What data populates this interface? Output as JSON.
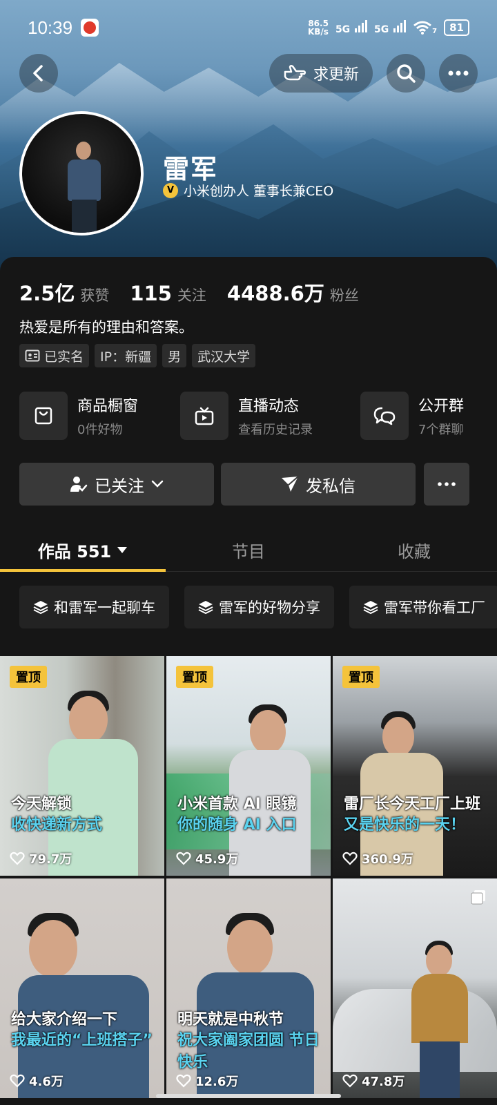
{
  "status_bar": {
    "time": "10:39",
    "net_speed_value": "86.5",
    "net_speed_unit": "KB/s",
    "sig1": "5G",
    "sig2": "5G",
    "wifi_sub": "7",
    "battery": "81"
  },
  "topbar": {
    "update_label": "求更新"
  },
  "profile": {
    "name": "雷军",
    "verified_title": "小米创办人 董事长兼CEO",
    "stats": [
      {
        "num": "2.5亿",
        "label": "获赞"
      },
      {
        "num": "115",
        "label": "关注"
      },
      {
        "num": "4488.6万",
        "label": "粉丝"
      }
    ],
    "bio": "热爱是所有的理由和答案。",
    "tags": [
      {
        "label": "已实名",
        "icon": "id-card-icon"
      },
      {
        "label": "IP：新疆"
      },
      {
        "label": "男"
      },
      {
        "label": "武汉大学"
      }
    ]
  },
  "services": [
    {
      "title": "商品橱窗",
      "subtitle": "0件好物",
      "icon": "shopping-bag-icon"
    },
    {
      "title": "直播动态",
      "subtitle": "查看历史记录",
      "icon": "tv-icon"
    },
    {
      "title": "公开群",
      "subtitle": "7个群聊",
      "icon": "chat-bubbles-icon"
    }
  ],
  "actions": {
    "follow_label": "已关注",
    "message_label": "发私信"
  },
  "tabs": [
    {
      "label": "作品 551",
      "active": true
    },
    {
      "label": "节目"
    },
    {
      "label": "收藏"
    }
  ],
  "collections": [
    {
      "label": "和雷军一起聊车"
    },
    {
      "label": "雷军的好物分享"
    },
    {
      "label": "雷军带你看工厂"
    }
  ],
  "videos": [
    {
      "pinned": true,
      "pin_label": "置顶",
      "line1": "今天解锁",
      "line2": "收快递新方式",
      "likes": "79.7万"
    },
    {
      "pinned": true,
      "pin_label": "置顶",
      "line1": "小米首款 AI 眼镜",
      "line2": "你的随身 AI 入口",
      "likes": "45.9万"
    },
    {
      "pinned": true,
      "pin_label": "置顶",
      "line1": "雷厂长今天工厂上班",
      "line2": "又是快乐的一天！",
      "likes": "360.9万"
    },
    {
      "pinned": false,
      "line1": "给大家介绍一下",
      "line2": "我最近的“上班搭子”",
      "likes": "4.6万"
    },
    {
      "pinned": false,
      "line1": "明天就是中秋节",
      "line2": "祝大家阖家团圆 节日快乐",
      "likes": "12.6万"
    },
    {
      "pinned": false,
      "line1": "",
      "line2": "",
      "likes": "47.8万",
      "multi": true
    }
  ],
  "colors": {
    "accent": "#f4c33b",
    "caption_blue": "#5ad3f0",
    "background": "#161616"
  }
}
